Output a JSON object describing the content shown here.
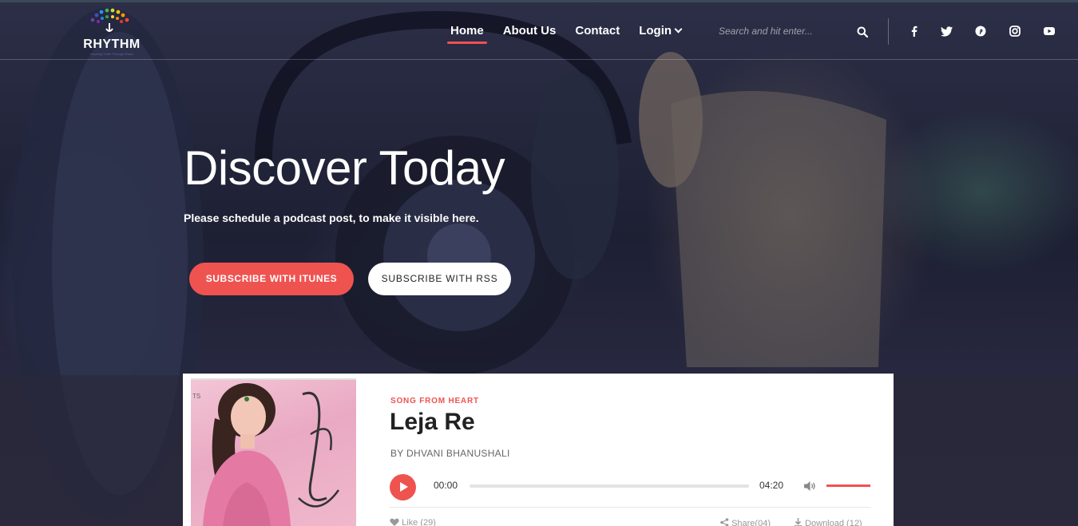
{
  "header": {
    "logo_text": "RHYTHM",
    "logo_tagline": "Inspiring Youth Through Music",
    "nav": [
      {
        "label": "Home",
        "active": true
      },
      {
        "label": "About Us",
        "active": false
      },
      {
        "label": "Contact",
        "active": false
      },
      {
        "label": "Login",
        "active": false,
        "dropdown": true
      }
    ],
    "search": {
      "placeholder": "Search and hit enter..."
    },
    "social_icons": [
      "facebook-icon",
      "twitter-icon",
      "pinterest-icon",
      "instagram-icon",
      "youtube-icon"
    ]
  },
  "hero": {
    "title": "Discover Today",
    "subtitle": "Please schedule a podcast post, to make it visible here.",
    "buttons": {
      "itunes": "SUBSCRIBE WITH ITUNES",
      "rss": "SUBSCRIBE WITH RSS"
    }
  },
  "card": {
    "cover_text": "TS",
    "kicker": "SONG FROM HEART",
    "title": "Leja Re",
    "artist": "BY DHVANI BHANUSHALI",
    "player": {
      "current_time": "00:00",
      "duration": "04:20",
      "progress": 0,
      "volume": 1.0
    },
    "meta": {
      "like": "Like (29)",
      "share": "Share(04)",
      "download": "Download (12)"
    }
  },
  "colors": {
    "accent": "#ef5350",
    "white": "#ffffff",
    "text_dark": "#222222"
  }
}
